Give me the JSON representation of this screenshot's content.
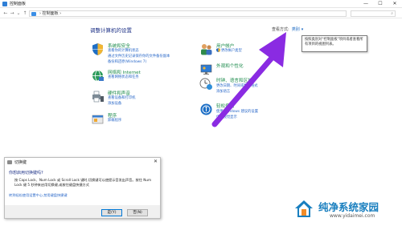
{
  "window": {
    "title": "控制面板",
    "min_label": "—",
    "max_label": "☐",
    "close_label": "✕"
  },
  "address_bar": {
    "breadcrumb": "› 控制面板 ›",
    "search_placeholder": "",
    "search_icon": "⌕"
  },
  "nav": {
    "back": "←",
    "forward": "→",
    "recent": "⌄",
    "up": "↑"
  },
  "header": {
    "title": "调整计算机的设置",
    "view_by_label": "查看方式:",
    "view_by_value": "类别",
    "view_by_caret": "▾"
  },
  "tooltip": {
    "text": "按照类别对\"控制面板\"项目或者查看所有项目的视图列表。"
  },
  "categories_left": [
    {
      "name": "系统和安全",
      "icon": "shield-icon",
      "links": [
        "查看你的计算机状态",
        "通过文件历史记录保存你的文件备份副本",
        "备份和还原(Windows 7)"
      ]
    },
    {
      "name": "网络和 Internet",
      "icon": "network-globe-icon",
      "links": [
        "查看网络状态和任务"
      ]
    },
    {
      "name": "硬件和声音",
      "icon": "printer-speaker-icon",
      "links": [
        "查看设备和打印机",
        "添加设备"
      ]
    },
    {
      "name": "程序",
      "icon": "programs-icon",
      "links": [
        "卸载程序"
      ]
    }
  ],
  "categories_right": [
    {
      "name": "用户帐户",
      "icon": "users-icon",
      "links": [
        "更改帐户类型"
      ]
    },
    {
      "name": "外观和个性化",
      "icon": "appearance-icon",
      "links": []
    },
    {
      "name": "时钟、语言和区域",
      "icon": "clock-globe-icon",
      "links": [
        "更改日期、时间或数字格式",
        "添加语言"
      ]
    },
    {
      "name": "轻松使用",
      "icon": "ease-of-access-icon",
      "links": [
        "使用 Windows 建议的设置",
        "优化视觉显示"
      ]
    }
  ],
  "dialog": {
    "title": "切换键",
    "close_label": "✕",
    "question": "你想启用切换键吗?",
    "message": "按 Caps Lock、Num Lock 或 Scroll Lock 键时,切换键可以使提示音发出声音。按住 Num Lock 键 5 秒钟来启用切换键,或按住键盘快捷方式",
    "settings_link": "转到轻松使用设置中心,禁用键盘快捷键",
    "yes_label": "是(Y)",
    "no_label": "否(N)"
  },
  "watermark": {
    "brand": "纯净系统家园",
    "url": "www.yidaimei.com"
  },
  "colors": {
    "title_blue": "#1e3287",
    "category_green": "#1a8a4a",
    "link_blue": "#2867c8",
    "arrow_purple": "#8a2be2",
    "watermark_blue": "#1a7fbf"
  }
}
